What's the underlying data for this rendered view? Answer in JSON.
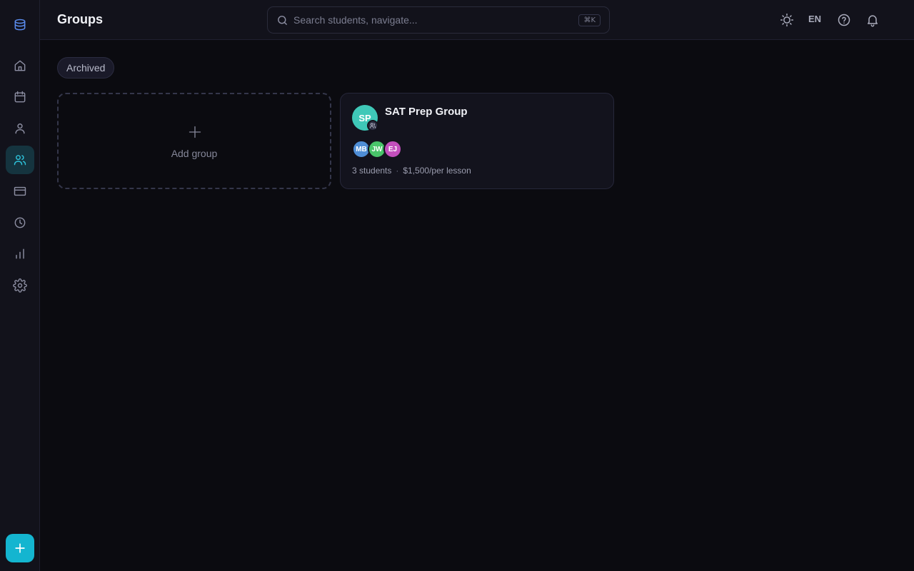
{
  "header": {
    "title": "Groups",
    "search_placeholder": "Search students, navigate...",
    "search_shortcut": "⌘K",
    "language": "EN"
  },
  "sidebar": {
    "items": [
      {
        "icon": "home-icon",
        "active": false
      },
      {
        "icon": "calendar-icon",
        "active": false
      },
      {
        "icon": "user-icon",
        "active": false
      },
      {
        "icon": "users-icon",
        "active": true
      },
      {
        "icon": "credit-card-icon",
        "active": false
      },
      {
        "icon": "clock-icon",
        "active": false
      },
      {
        "icon": "bar-chart-icon",
        "active": false
      },
      {
        "icon": "gear-icon",
        "active": false
      }
    ],
    "accent_color": "#14b5d0"
  },
  "filter": {
    "archived_label": "Archived"
  },
  "add_card": {
    "label": "Add group"
  },
  "groups": [
    {
      "initials": "SP",
      "name": "SAT Prep Group",
      "avatar_color": "#3fc8b8",
      "members": [
        {
          "initials": "MB",
          "color": "#4f8ed6"
        },
        {
          "initials": "JW",
          "color": "#49c46a"
        },
        {
          "initials": "EJ",
          "color": "#c34fbd"
        }
      ],
      "students": "3 students",
      "separator": "·",
      "price": "$1,500/per lesson"
    }
  ]
}
